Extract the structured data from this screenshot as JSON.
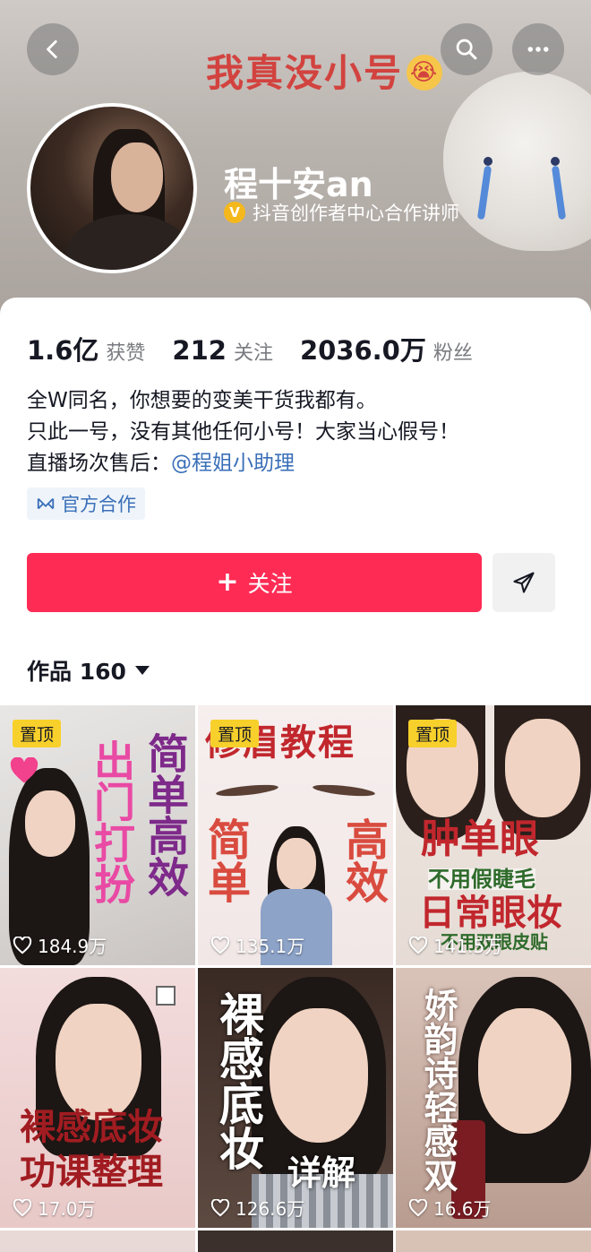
{
  "header": {
    "banner_title": "我真没小号",
    "banner_emoji": "😭",
    "back_icon": "chevron-left-icon",
    "search_icon": "search-icon",
    "more_icon": "more-icon"
  },
  "profile": {
    "name": "程十安an",
    "verify_badge": "V",
    "verify_text": "抖音创作者中心合作讲师",
    "stats": [
      {
        "num": "1.6亿",
        "label": "获赞"
      },
      {
        "num": "212",
        "label": "关注"
      },
      {
        "num": "2036.0万",
        "label": "粉丝"
      }
    ],
    "bio_line1": "全W同名，你想要的变美干货我都有。",
    "bio_line2": "只此一号，没有其他任何小号！大家当心假号！",
    "bio_line3_prefix": "直播场次售后：",
    "bio_line3_mention": "@程姐小助理",
    "official_tag": "官方合作"
  },
  "actions": {
    "follow_plus": "+",
    "follow_label": "关注"
  },
  "works": {
    "label": "作品 160"
  },
  "videos": [
    {
      "pinned": "置顶",
      "likes": "184.9万",
      "text_a": "简单高效",
      "text_b": "出门打扮"
    },
    {
      "pinned": "置顶",
      "likes": "135.1万",
      "text_a": "修眉教程",
      "text_b": "简单",
      "text_c": "高效"
    },
    {
      "pinned": "置顶",
      "likes": "141.5万",
      "text_a": "肿单眼",
      "text_b": "不用假睫毛",
      "text_c": "日常眼妆",
      "text_d": "不用双眼皮贴"
    },
    {
      "likes": "17.0万",
      "text_a": "裸感底妆",
      "text_b": "功课整理"
    },
    {
      "likes": "126.6万",
      "text_a": "裸感底妆",
      "text_b": "详解"
    },
    {
      "likes": "16.6万",
      "text_a": "娇韵诗轻感双"
    }
  ],
  "colors": {
    "accent": "#fe2c55",
    "link": "#3a6fb8",
    "pin": "#f8d02b"
  }
}
